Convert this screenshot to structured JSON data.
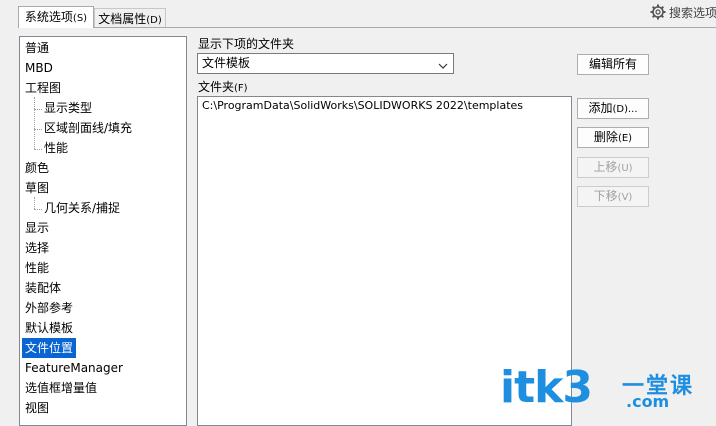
{
  "tabs": {
    "system_options": {
      "label": "系统选项",
      "hotkey": "(S)"
    },
    "document_properties": {
      "label": "文档属性",
      "hotkey": "(D)"
    }
  },
  "search": {
    "label": "搜索选项",
    "icon": "gear-icon"
  },
  "tree": {
    "items": [
      {
        "label": "普通",
        "level": 0
      },
      {
        "label": "MBD",
        "level": 0
      },
      {
        "label": "工程图",
        "level": 0
      },
      {
        "label": "显示类型",
        "level": 1
      },
      {
        "label": "区域剖面线/填充",
        "level": 1
      },
      {
        "label": "性能",
        "level": 1
      },
      {
        "label": "颜色",
        "level": 0
      },
      {
        "label": "草图",
        "level": 0
      },
      {
        "label": "几何关系/捕捉",
        "level": 1
      },
      {
        "label": "显示",
        "level": 0
      },
      {
        "label": "选择",
        "level": 0
      },
      {
        "label": "性能",
        "level": 0
      },
      {
        "label": "装配体",
        "level": 0
      },
      {
        "label": "外部参考",
        "level": 0
      },
      {
        "label": "默认模板",
        "level": 0
      },
      {
        "label": "文件位置",
        "level": 0,
        "selected": true
      },
      {
        "label": "FeatureManager",
        "level": 0
      },
      {
        "label": "选值框增量值",
        "level": 0
      },
      {
        "label": "视图",
        "level": 0
      }
    ],
    "selected_color": "#0a64d2"
  },
  "show_folders_for": {
    "label": "显示下项的文件夹",
    "selected": "文件模板"
  },
  "folders": {
    "label": "文件夹",
    "hotkey": "(F)",
    "paths": [
      "C:\\ProgramData\\SolidWorks\\SOLIDWORKS 2022\\templates"
    ]
  },
  "buttons": {
    "edit_all": {
      "label": "编辑所有",
      "hotkey": "",
      "enabled": true
    },
    "add": {
      "label": "添加",
      "hotkey": "(D)...",
      "enabled": true
    },
    "delete": {
      "label": "删除",
      "hotkey": "(E)",
      "enabled": true
    },
    "move_up": {
      "label": "上移",
      "hotkey": "(U)",
      "enabled": false
    },
    "move_down": {
      "label": "下移",
      "hotkey": "(V)",
      "enabled": false
    }
  },
  "watermark": {
    "main": "itk3",
    "cn": "一堂课",
    "dotcom": ".com",
    "color": "#1e8fe0"
  }
}
